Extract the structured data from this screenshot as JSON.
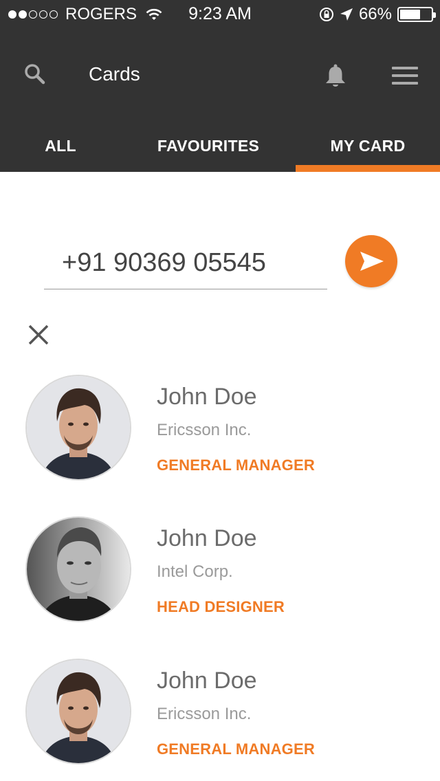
{
  "status_bar": {
    "signal_full": 2,
    "signal_total": 5,
    "carrier": "ROGERS",
    "time": "9:23 AM",
    "battery_text": "66%",
    "battery_level": 0.66
  },
  "toolbar": {
    "title": "Cards",
    "icons": [
      "search-icon",
      "bell-icon",
      "hamburger-menu-icon"
    ]
  },
  "tabs": [
    {
      "label": "ALL",
      "active": false
    },
    {
      "label": "FAVOURITES",
      "active": false
    },
    {
      "label": "MY CARD",
      "active": true
    }
  ],
  "phone_input": {
    "value": "+91 90369 05545"
  },
  "send_button": {
    "icon": "send-icon"
  },
  "close_button": {
    "icon": "close-icon"
  },
  "cards": [
    {
      "name": "John Doe",
      "company": "Ericsson Inc.",
      "role": "GENERAL MANAGER",
      "avatar": "portrait-dark-hair"
    },
    {
      "name": "John Doe",
      "company": "Intel Corp.",
      "role": "HEAD DESIGNER",
      "avatar": "portrait-grayscale"
    },
    {
      "name": "John Doe",
      "company": "Ericsson Inc.",
      "role": "GENERAL MANAGER",
      "avatar": "portrait-dark-hair"
    }
  ],
  "colors": {
    "header_bg": "#333333",
    "accent": "#f07b25",
    "name_text": "#6b6b6b",
    "company_text": "#9a9a9a"
  }
}
